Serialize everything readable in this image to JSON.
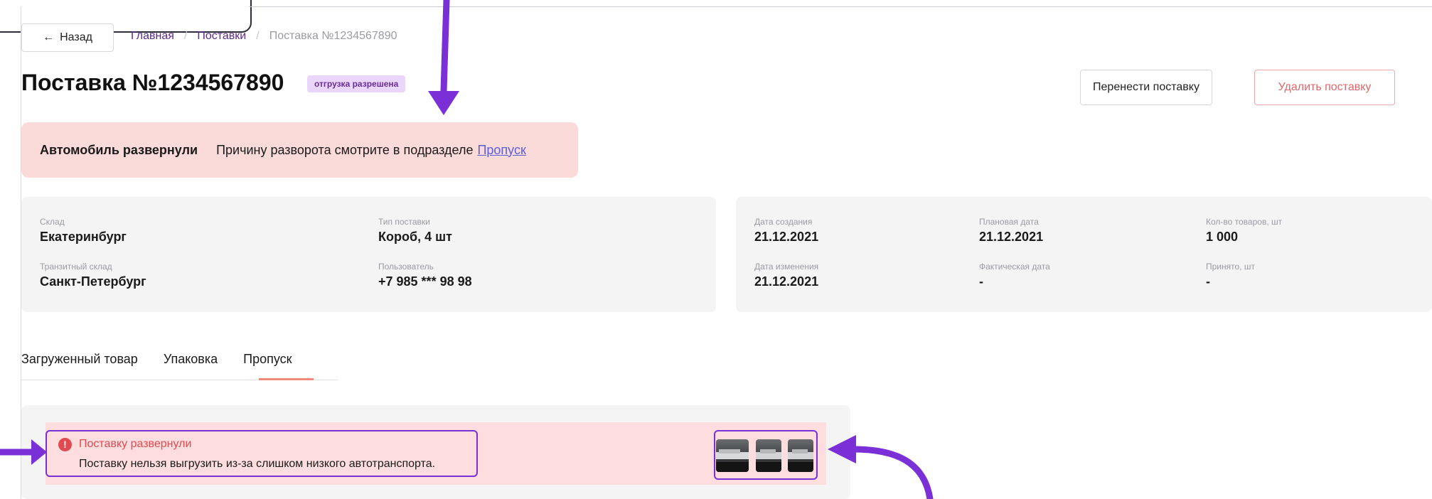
{
  "nav": {
    "back_label": "Назад",
    "breadcrumbs": [
      "Главная",
      "Поставки",
      "Поставка №1234567890"
    ]
  },
  "header": {
    "title": "Поставка №1234567890",
    "status_badge": "отгрузка разрешена",
    "move_button": "Перенести поставку",
    "delete_button": "Удалить поставку"
  },
  "top_alert": {
    "bold": "Автомобиль развернули",
    "text": "Причину разворота смотрите в подразделе",
    "link": "Пропуск"
  },
  "info_left": [
    {
      "label": "Склад",
      "value": "Екатеринбург"
    },
    {
      "label": "Тип поставки",
      "value": "Короб, 4 шт"
    },
    {
      "label": "Транзитный склад",
      "value": "Санкт-Петербург"
    },
    {
      "label": "Пользователь",
      "value": "+7 985 *** 98 98"
    }
  ],
  "info_right": [
    {
      "label": "Дата создания",
      "value": "21.12.2021"
    },
    {
      "label": "Плановая дата",
      "value": "21.12.2021"
    },
    {
      "label": "Кол-во товаров, шт",
      "value": "1 000"
    },
    {
      "label": "Дата изменения",
      "value": "21.12.2021"
    },
    {
      "label": "Фактическая дата",
      "value": "-"
    },
    {
      "label": "Принято, шт",
      "value": "-"
    }
  ],
  "tabs": [
    "Загруженный товар",
    "Упаковка",
    "Пропуск"
  ],
  "active_tab": "Пропуск",
  "pass_alert": {
    "title": "Поставку развернули",
    "text": "Поставку нельзя выгрузить из-за слишком низкого автотранспорта."
  },
  "colors": {
    "accent_purple": "#7b2fd6",
    "alert_bg": "#fbdada",
    "error_red": "#e24a52",
    "link_blue": "#5a5fd6"
  }
}
